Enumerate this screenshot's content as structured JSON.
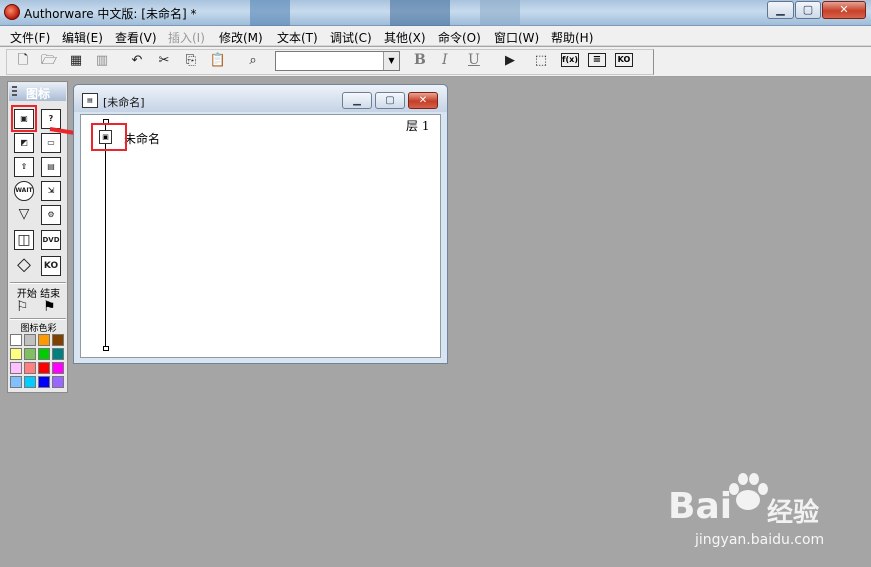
{
  "window": {
    "title": "Authorware 中文版: [未命名] *",
    "minimize_glyph": "▁",
    "maximize_glyph": "▢",
    "close_glyph": "✕"
  },
  "menu": [
    {
      "label": "文件(F)",
      "enabled": true
    },
    {
      "label": "编辑(E)",
      "enabled": true
    },
    {
      "label": "查看(V)",
      "enabled": true
    },
    {
      "label": "插入(I)",
      "enabled": false
    },
    {
      "label": "修改(M)",
      "enabled": true
    },
    {
      "label": "文本(T)",
      "enabled": true
    },
    {
      "label": "调试(C)",
      "enabled": true
    },
    {
      "label": "其他(X)",
      "enabled": true
    },
    {
      "label": "命令(O)",
      "enabled": true
    },
    {
      "label": "窗口(W)",
      "enabled": true
    },
    {
      "label": "帮助(H)",
      "enabled": true
    }
  ],
  "toolbar": {
    "new_icon": "new-file-icon",
    "open_icon": "open-folder-icon",
    "save_all_icon": "save-all-icon",
    "import_icon": "import-icon",
    "undo_icon": "undo-icon",
    "cut_icon": "cut-icon",
    "copy_icon": "copy-icon",
    "paste_icon": "paste-icon",
    "find_icon": "find-icon",
    "style_combo_value": "",
    "bold": "B",
    "italic": "I",
    "underline": "U",
    "run_icon": "run-icon",
    "control_panel_icon": "control-panel-icon",
    "functions_label": "f(x)",
    "variables_icon": "variables-icon",
    "knowledge_objects_label": "KO"
  },
  "palette": {
    "title": "图标",
    "start_label": "开始",
    "end_label": "结束",
    "color_label": "图标色彩",
    "icons": [
      {
        "name": "display",
        "glyph": "▣"
      },
      {
        "name": "motion",
        "glyph": "?"
      },
      {
        "name": "erase",
        "glyph": "◩"
      },
      {
        "name": "wait-box",
        "glyph": "▭"
      },
      {
        "name": "navigate",
        "glyph": "⇧"
      },
      {
        "name": "calc",
        "glyph": "▤"
      },
      {
        "name": "wait",
        "glyph": "WAIT"
      },
      {
        "name": "framework",
        "glyph": "⇲"
      },
      {
        "name": "decision",
        "glyph": "▽"
      },
      {
        "name": "interaction",
        "glyph": "⚙"
      },
      {
        "name": "map",
        "glyph": "◫"
      },
      {
        "name": "dvd",
        "glyph": "DVD"
      },
      {
        "name": "decision-diamond",
        "glyph": "◇"
      },
      {
        "name": "knowledge-object",
        "glyph": "KO"
      }
    ],
    "colors": [
      "#ffffff",
      "#c0c0c0",
      "#ff9900",
      "#804000",
      "#ffff80",
      "#80c060",
      "#00cc00",
      "#008080",
      "#ffc0ff",
      "#ff8080",
      "#ff0000",
      "#ff00ff",
      "#80c0ff",
      "#00ccff",
      "#0000ff",
      "#9966ff"
    ]
  },
  "design_window": {
    "title": "[未命名]",
    "level_label": "层 1",
    "flow_icon_name": "未命名"
  },
  "watermark": {
    "logo_left": "Bai",
    "logo_right": "经验",
    "url": "jingyan.baidu.com"
  }
}
